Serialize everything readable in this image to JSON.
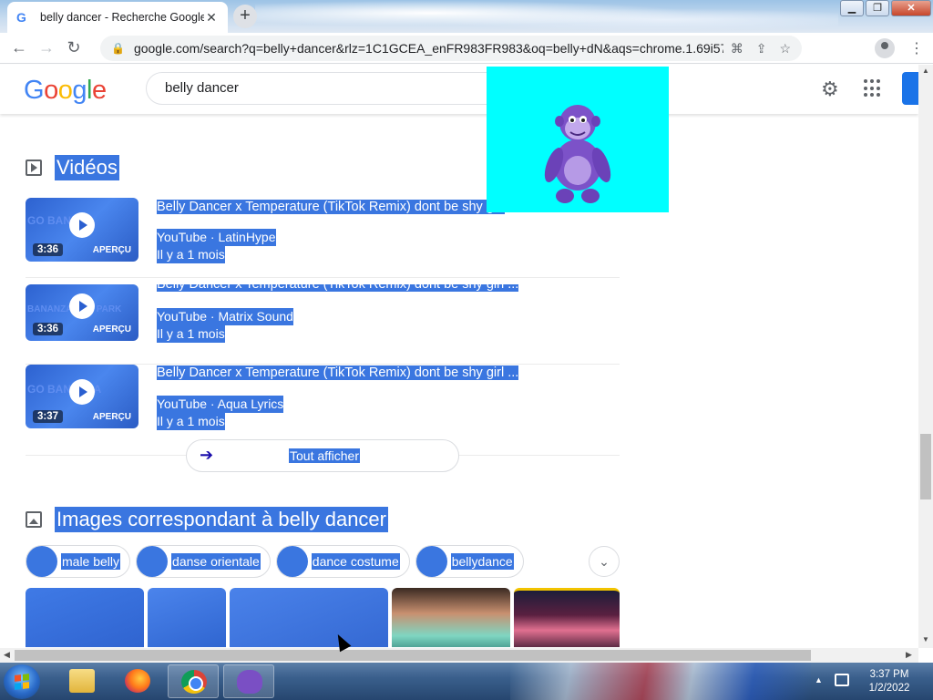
{
  "browser": {
    "tab_title": "belly dancer - Recherche Google",
    "tab_favicon": "G",
    "tab_close": "✕",
    "new_tab": "+",
    "url": "google.com/search?q=belly+dancer&rlz=1C1GCEA_enFR983FR983&oq=belly+dN&aqs=chrome.1.69i57j0i10i51...",
    "window_buttons": {
      "minimize": "▁",
      "restore": "❐",
      "close": "✕"
    },
    "nav": {
      "back": "←",
      "forward": "→",
      "reload": "↻"
    },
    "omni_icons": [
      "translate-icon",
      "share-icon",
      "star-icon"
    ]
  },
  "google": {
    "logo": [
      "G",
      "o",
      "o",
      "g",
      "l",
      "e"
    ],
    "query": "belly dancer"
  },
  "videos": {
    "heading": "Vidéos",
    "items": [
      {
        "title": "Belly Dancer x Temperature (TikTok Remix) dont be shy g...",
        "source": "YouTube · LatinHype",
        "age": "Il y a 1 mois",
        "duration": "3:36",
        "preview": "APERÇU",
        "watermark": "GO BANZA"
      },
      {
        "title": "Belly Dancer x Temperature (TikTok Remix) dont be shy girl ...",
        "source": "YouTube · Matrix Sound",
        "age": "Il y a 1 mois",
        "duration": "3:36",
        "preview": "APERÇU",
        "watermark": "BANANZA   BEN PARK"
      },
      {
        "title": "Belly Dancer x Temperature (TikTok Remix) dont be shy girl ...",
        "source": "YouTube · Aqua Lyrics",
        "age": "Il y a 1 mois",
        "duration": "3:37",
        "preview": "APERÇU",
        "watermark": "GO BANANZA"
      }
    ],
    "show_all": "Tout afficher"
  },
  "images": {
    "heading": "Images correspondant à belly dancer",
    "chips": [
      "male belly",
      "danse orientale",
      "dance costume",
      "bellydance"
    ]
  },
  "taskbar": {
    "time": "3:37 PM",
    "date": "1/2/2022"
  },
  "colors": {
    "selection": "#3a76e0",
    "overlay_bg": "#00ffff",
    "google_blue": "#4285f4"
  }
}
